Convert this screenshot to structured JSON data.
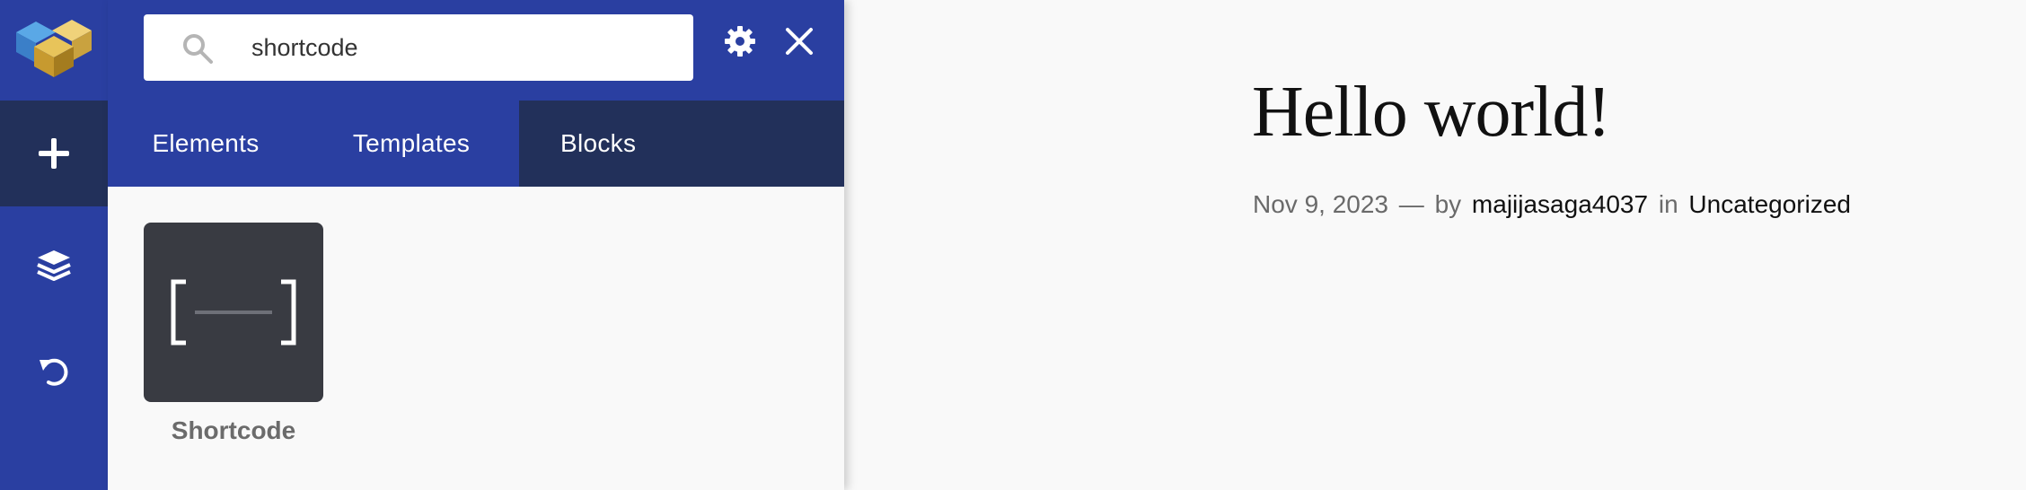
{
  "colors": {
    "brand_blue": "#2a3fa1",
    "active_dark": "#22305a",
    "card_bg": "#393b42",
    "page_bg": "#f9f9f9"
  },
  "rail": {
    "logo_icon": "builder-cube-logo",
    "buttons": [
      {
        "icon": "plus-icon",
        "active": true
      },
      {
        "icon": "layers-icon",
        "active": false
      },
      {
        "icon": "undo-icon",
        "active": false
      }
    ]
  },
  "panel": {
    "search": {
      "value": "shortcode",
      "icon": "search-icon"
    },
    "settings_icon": "gear-icon",
    "close_icon": "close-icon",
    "tabs": [
      {
        "label": "Elements",
        "active": false
      },
      {
        "label": "Templates",
        "active": false
      },
      {
        "label": "Blocks",
        "active": true
      }
    ],
    "elements": [
      {
        "label": "Shortcode",
        "icon": "shortcode-brackets-icon"
      }
    ]
  },
  "post": {
    "title": "Hello world!",
    "date": "Nov 9, 2023",
    "separator": "—",
    "by_label": "by",
    "author": "majijasaga4037",
    "in_label": "in",
    "category": "Uncategorized"
  }
}
